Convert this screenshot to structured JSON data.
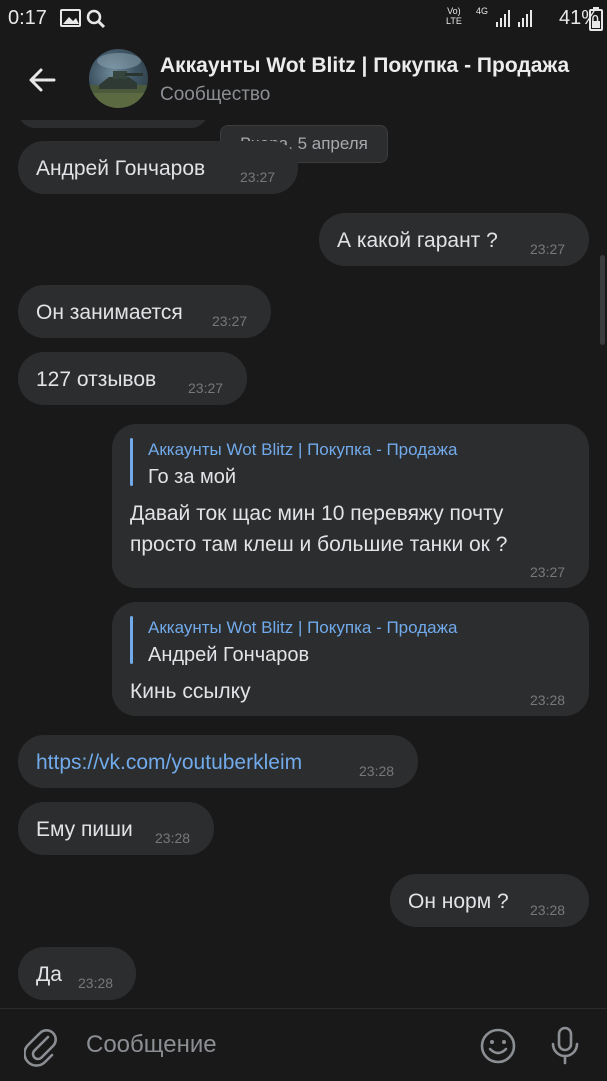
{
  "status_bar": {
    "time": "0:17",
    "battery": "41%",
    "volte_top": "Vo)",
    "volte_bottom": "LTE",
    "net": "4G"
  },
  "header": {
    "title": "Аккаунты Wot Blitz | Покупка - Продажа",
    "subtitle": "Сообщество"
  },
  "date_separator": "Вчера, 5 апреля",
  "messages": [
    {
      "side": "in",
      "text": "Андрей Гончаров",
      "time": "23:27"
    },
    {
      "side": "out",
      "text": "А какой гарант ?",
      "time": "23:27"
    },
    {
      "side": "in",
      "text": "Он занимается",
      "time": "23:27"
    },
    {
      "side": "in",
      "text": "127 отзывов",
      "time": "23:27"
    },
    {
      "side": "out",
      "reply_title": "Аккаунты Wot Blitz | Покупка - Продажа",
      "reply_text": "Го за мой",
      "lines": [
        "Давай ток щас мин 10 перевяжу почту",
        "просто там клеш и большие танки ок ?"
      ],
      "time": "23:27"
    },
    {
      "side": "out",
      "reply_title": "Аккаунты Wot Blitz | Покупка - Продажа",
      "reply_text": "Андрей Гончаров",
      "text": "Кинь ссылку",
      "time": "23:28"
    },
    {
      "side": "in",
      "text": "https://vk.com/youtuberkleim",
      "time": "23:28"
    },
    {
      "side": "in",
      "text": "Ему пиши",
      "time": "23:28"
    },
    {
      "side": "out",
      "text": "Он норм ?",
      "time": "23:28"
    },
    {
      "side": "in",
      "text": "Да",
      "time": "23:28"
    }
  ],
  "composer": {
    "placeholder": "Сообщение"
  },
  "colors": {
    "background": "#19191a",
    "bubble": "#2c2d2e",
    "accent": "#71aaeb"
  }
}
